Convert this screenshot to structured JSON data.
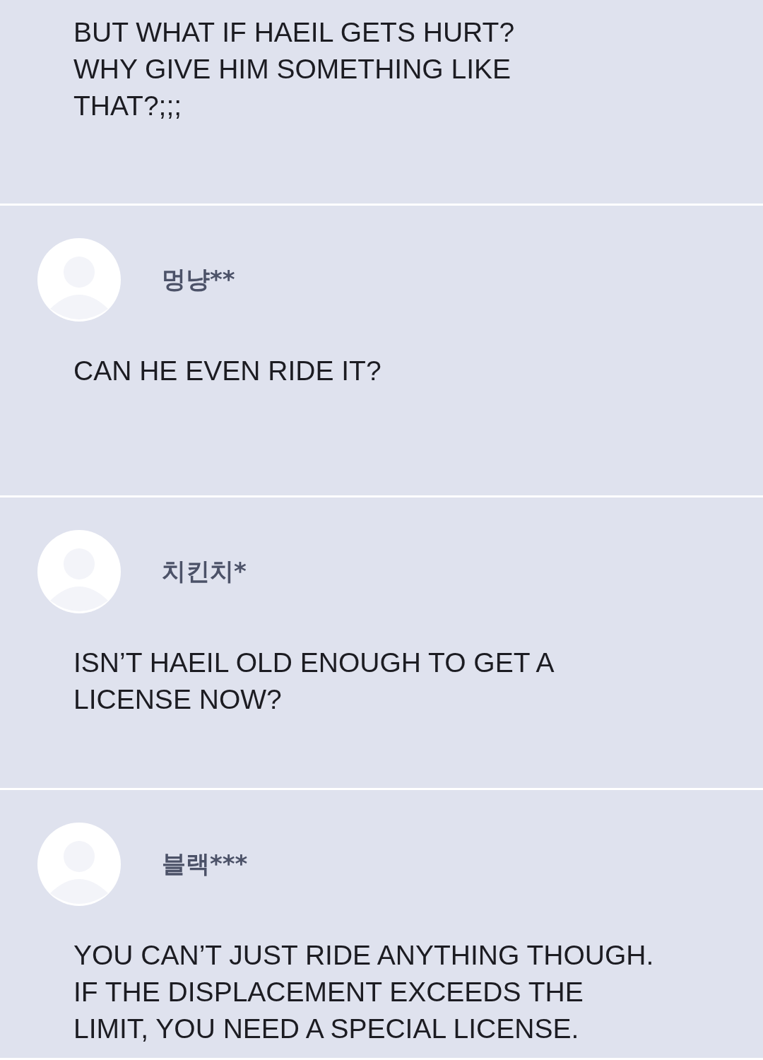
{
  "comments": [
    {
      "text": "BUT WHAT IF HAEIL GETS HURT?\nWHY GIVE HIM SOMETHING LIKE\nTHAT?;;;"
    },
    {
      "author": "멍냥**",
      "text": "CAN HE EVEN RIDE IT?"
    },
    {
      "author": "치킨치*",
      "text": "ISN’T HAEIL OLD ENOUGH TO GET A\nLICENSE NOW?"
    },
    {
      "author": "블랙***",
      "text": "YOU CAN’T JUST RIDE ANYTHING THOUGH.\nIF THE DISPLACEMENT EXCEEDS THE\nLIMIT, YOU NEED A SPECIAL LICENSE."
    }
  ]
}
